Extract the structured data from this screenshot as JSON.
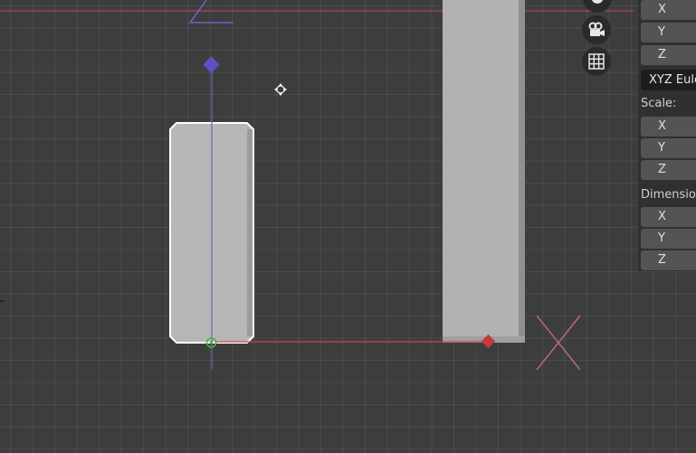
{
  "viewport": {
    "colors": {
      "background": "#3d3d3d",
      "x_axis": "#c24a4a",
      "z_axis": "#6b62c8",
      "object_fill": "#b4b4b4",
      "selection_outline": "#ffffff"
    }
  },
  "gizmos": [
    {
      "name": "hand-icon"
    },
    {
      "name": "camera-icon"
    },
    {
      "name": "grid-icon"
    }
  ],
  "npanel": {
    "rotation_fields": [
      "X",
      "Y",
      "Z"
    ],
    "rotation_mode": "XYZ Euler",
    "scale_label": "Scale:",
    "scale_fields": [
      "X",
      "Y",
      "Z"
    ],
    "dimensions_label": "Dimensions:",
    "dimensions_fields": [
      "X",
      "Y",
      "Z"
    ]
  }
}
